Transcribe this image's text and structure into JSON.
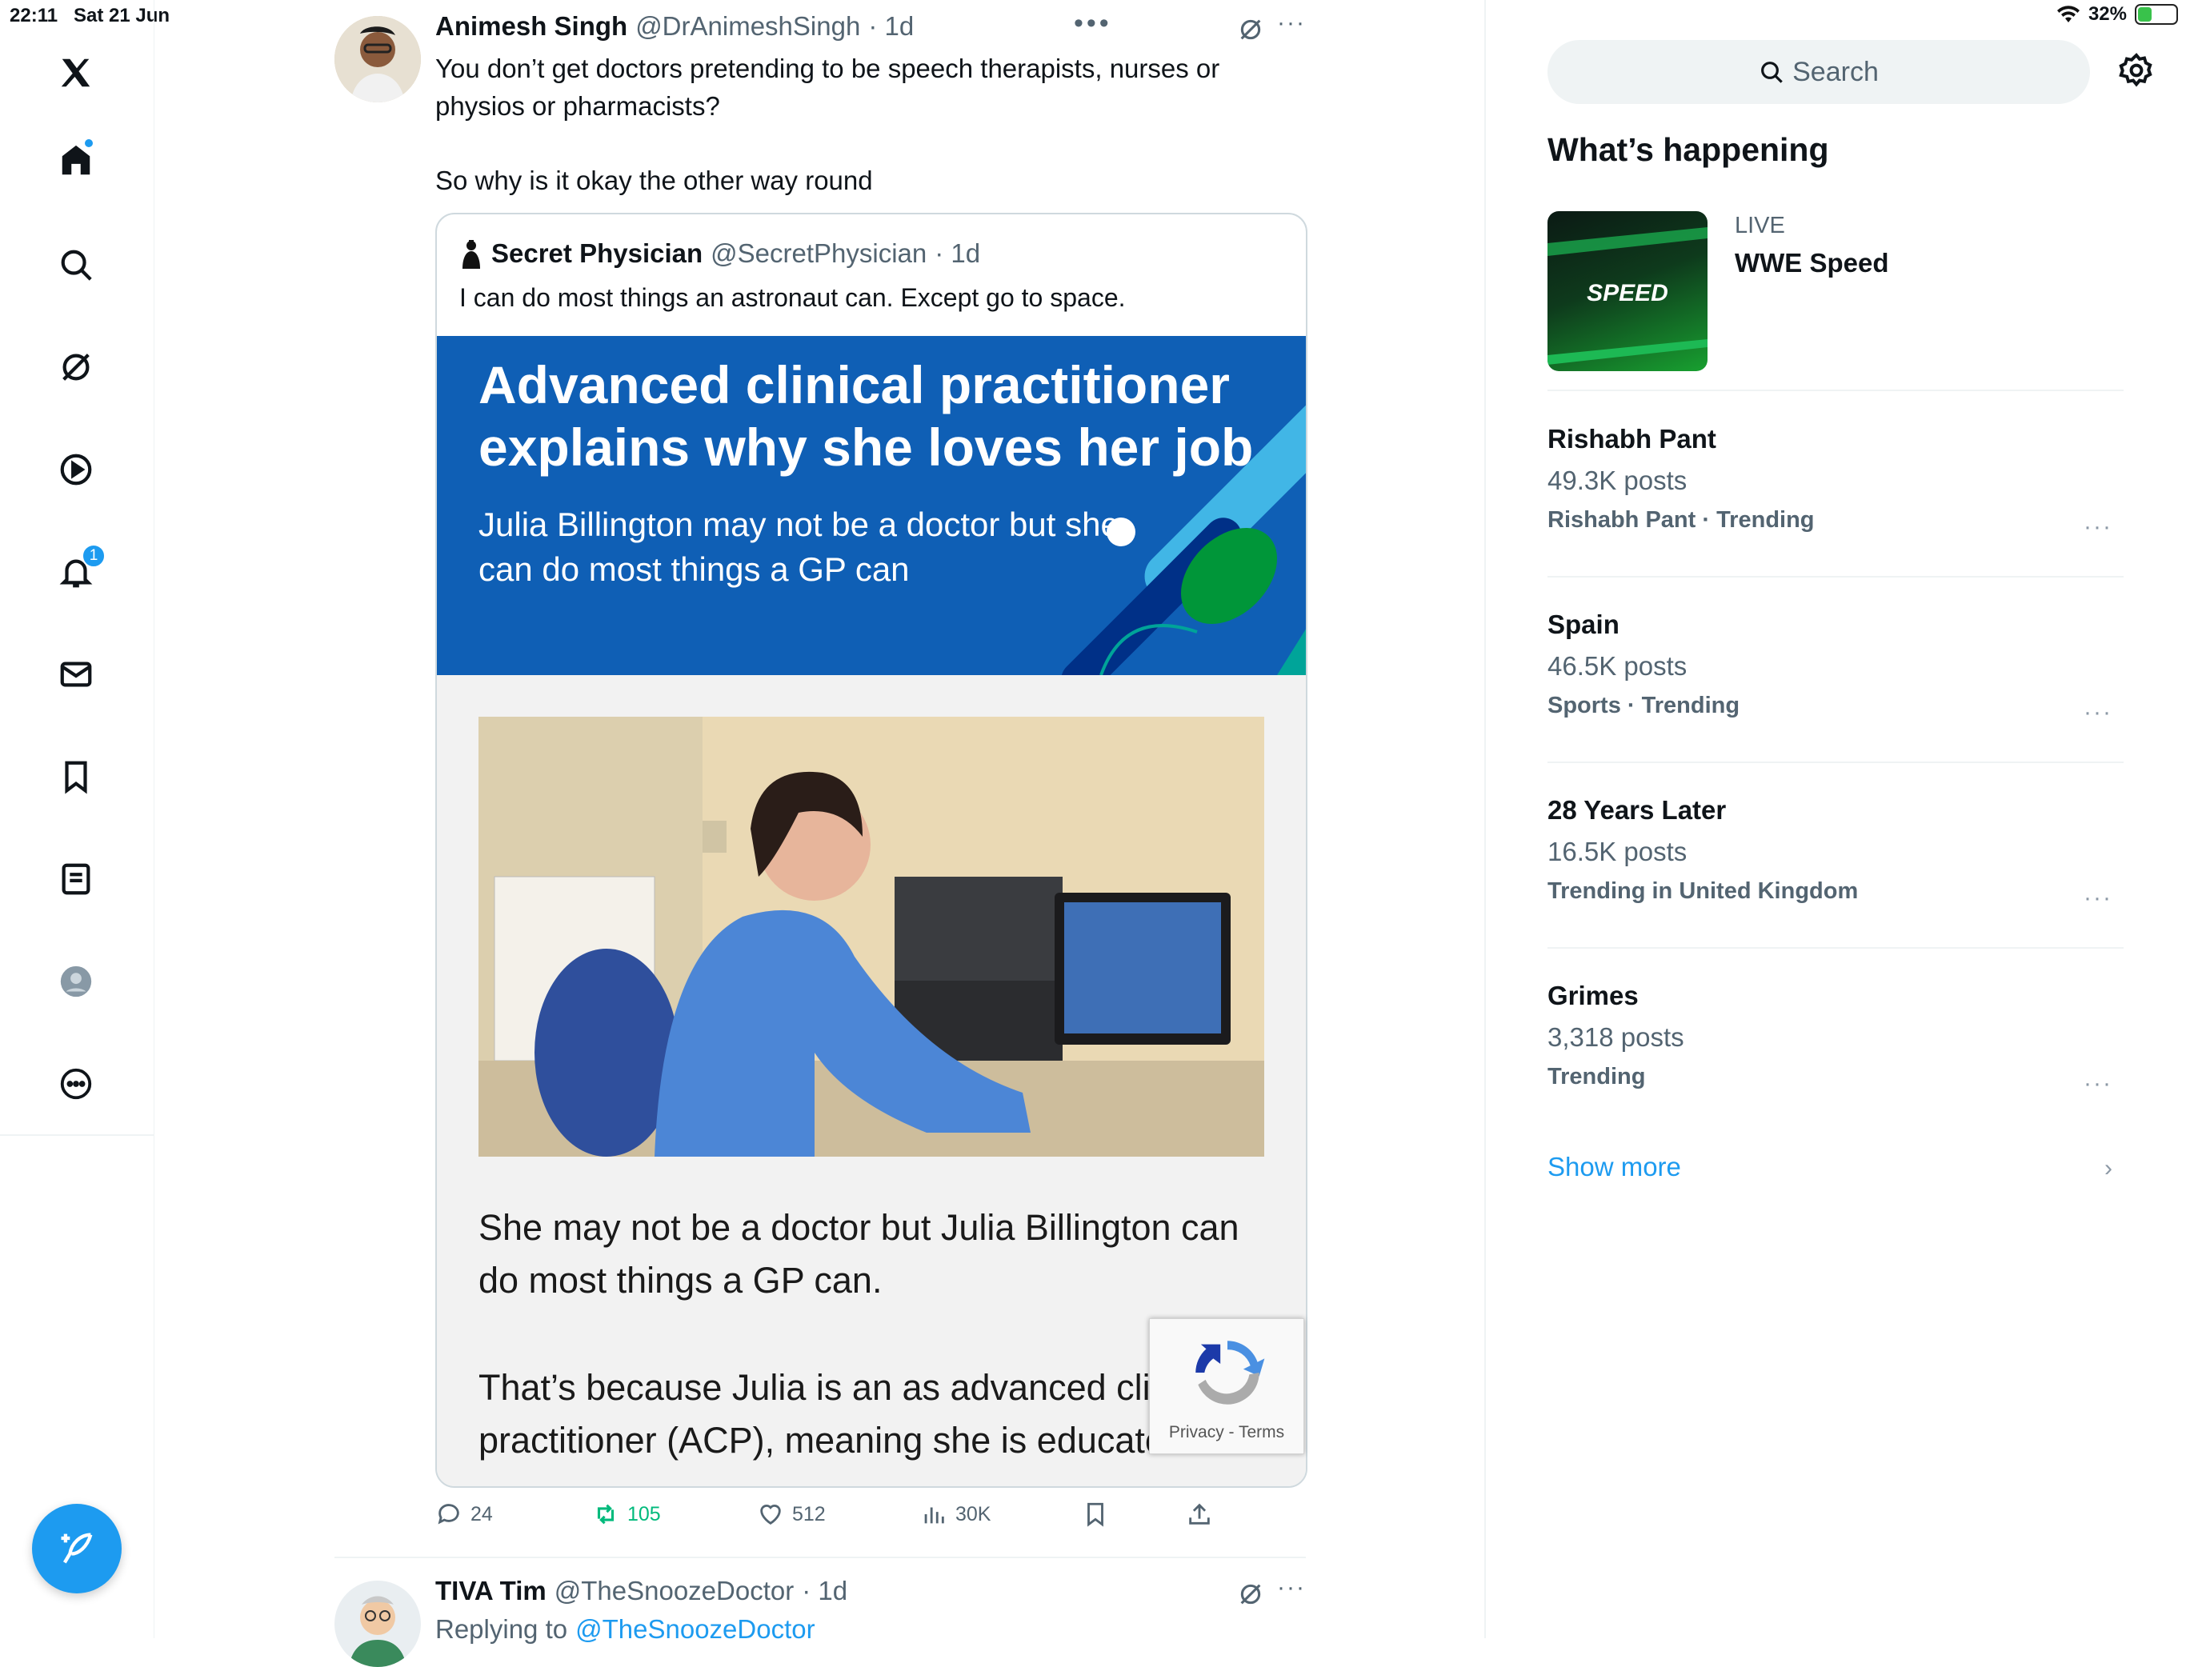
{
  "status_bar": {
    "time": "22:11",
    "date": "Sat 21 Jun",
    "battery": "32%"
  },
  "nav": {
    "notifications_badge": "1"
  },
  "tweet": {
    "name": "Animesh Singh",
    "handle": "@DrAnimeshSingh",
    "time": "· 1d",
    "text_line1": "You don’t get doctors pretending to be speech therapists, nurses or",
    "text_line2": "physios or pharmacists?",
    "text_line3": "So why is it okay the other way round",
    "quote": {
      "name": "Secret Physician",
      "handle": "@SecretPhysician",
      "time": "· 1d",
      "text": "I can do most things an astronaut can. Except go to space.",
      "banner_title": "Advanced clinical practitioner explains why she loves her job",
      "banner_subtitle": "Julia Billington may not be a doctor but she can do most things a GP can",
      "para1": "She may not be a doctor but Julia Billington can do most things a GP can.",
      "para2": "That’s because Julia is an as advanced clir practitioner (ACP), meaning she is educated to"
    },
    "actions": {
      "replies": "24",
      "retweets": "105",
      "likes": "512",
      "views": "30K"
    }
  },
  "recaptcha": {
    "label": "Privacy - Terms"
  },
  "next_tweet": {
    "name": "TIVA Tim",
    "handle": "@TheSnoozeDoctor",
    "time": "· 1d",
    "replying_prefix": "Replying to",
    "replying_handle": "@TheSnoozeDoctor"
  },
  "sidebar": {
    "search_placeholder": "Search",
    "section_title": "What’s happening",
    "live": {
      "label": "LIVE",
      "title": "WWE Speed",
      "logo": "SPEED"
    },
    "trends": [
      {
        "title": "Rishabh Pant",
        "posts": "49.3K posts",
        "context": "Rishabh Pant · Trending"
      },
      {
        "title": "Spain",
        "posts": "46.5K posts",
        "context": "Sports · Trending"
      },
      {
        "title": "28 Years Later",
        "posts": "16.5K posts",
        "context": "Trending in United Kingdom"
      },
      {
        "title": "Grimes",
        "posts": "3,318 posts",
        "context": "Trending"
      }
    ],
    "show_more": "Show more"
  },
  "colors": {
    "accent": "#1d9bf0",
    "retweet_green": "#00ba7c",
    "banner_blue": "#0f5fb5"
  }
}
